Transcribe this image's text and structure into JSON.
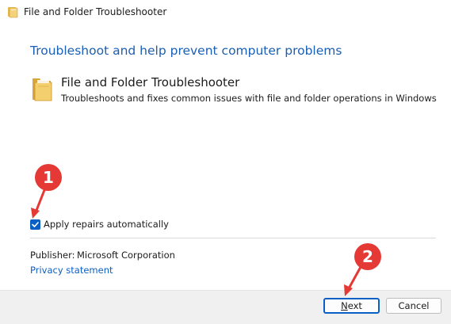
{
  "window": {
    "title": "File and Folder Troubleshooter",
    "icon": "folder-icon"
  },
  "main": {
    "heading": "Troubleshoot and help prevent computer problems",
    "tool": {
      "icon": "folder-icon",
      "name": "File and Folder Troubleshooter",
      "description": "Troubleshoots and fixes common issues with file and folder operations in Windows"
    },
    "apply_repairs": {
      "label": "Apply repairs automatically",
      "checked": true
    },
    "publisher": {
      "label": "Publisher:",
      "value": "Microsoft Corporation"
    },
    "privacy_link": "Privacy statement"
  },
  "footer": {
    "next_first": "N",
    "next_rest": "ext",
    "cancel_label": "Cancel"
  },
  "annotations": {
    "badge_1": "1",
    "badge_2": "2",
    "badge_color": "#e53935"
  },
  "colors": {
    "accent": "#0a5fc4",
    "heading": "#1a5fb4",
    "footer_bg": "#f0f0f0"
  }
}
